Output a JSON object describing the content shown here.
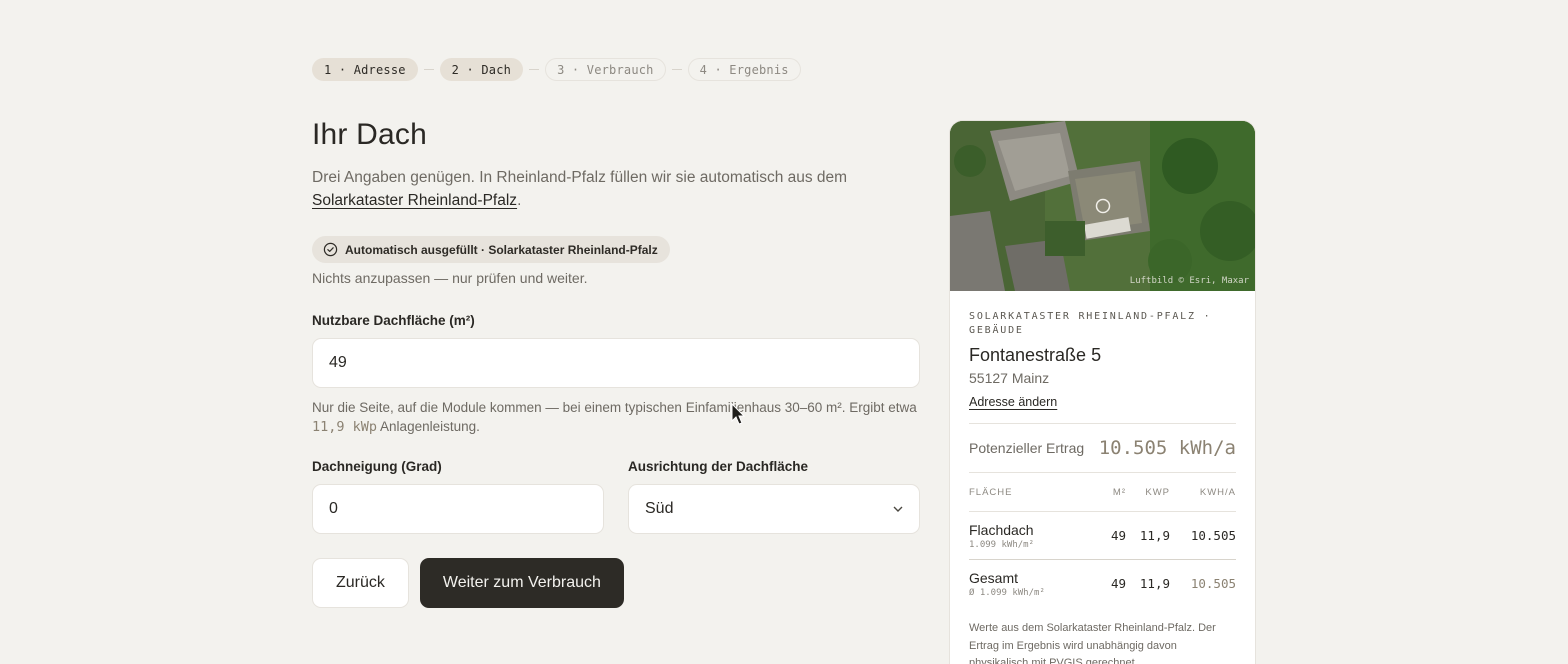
{
  "stepper": {
    "steps": [
      {
        "label": "1 · Adresse",
        "state": "done"
      },
      {
        "label": "2 · Dach",
        "state": "done"
      },
      {
        "label": "3 · Verbrauch",
        "state": "pending"
      },
      {
        "label": "4 · Ergebnis",
        "state": "pending"
      }
    ]
  },
  "main": {
    "title": "Ihr Dach",
    "intro_text": "Drei Angaben genügen. In Rheinland-Pfalz füllen wir sie automatisch aus dem",
    "intro_link": "Solarkataster Rheinland-Pfalz",
    "intro_end": ".",
    "badge": "Automatisch ausgefüllt · Solarkataster Rheinland-Pfalz",
    "badge_note": "Nichts anzupassen — nur prüfen und weiter.",
    "area": {
      "label": "Nutzbare Dachfläche (m²)",
      "value": "49",
      "help_before": "Nur die Seite, auf die Module kommen — bei einem typischen Einfamilienhaus 30–60 m². Ergibt etwa",
      "help_value": "11,9 kWp",
      "help_after": "Anlagenleistung."
    },
    "tilt": {
      "label": "Dachneigung (Grad)",
      "value": "0"
    },
    "orientation": {
      "label": "Ausrichtung der Dachfläche",
      "value": "Süd"
    },
    "buttons": {
      "back": "Zurück",
      "next": "Weiter zum Verbrauch"
    }
  },
  "card": {
    "credit": "Luftbild © Esri, Maxar",
    "eyebrow": "SOLARKATASTER RHEINLAND-PFALZ · GEBÄUDE",
    "street": "Fontanestraße 5",
    "city": "55127 Mainz",
    "change_link": "Adresse ändern",
    "yield_label": "Potenzieller Ertrag",
    "yield_value": "10.505 kWh/a",
    "table": {
      "headers": [
        "FLÄCHE",
        "M²",
        "KWP",
        "KWH/A"
      ],
      "rows": [
        {
          "name": "Flachdach",
          "sub": "1.099 kWh/m²",
          "m2": "49",
          "kwp": "11,9",
          "kwh": "10.505"
        }
      ],
      "total": {
        "name": "Gesamt",
        "sub": "Ø 1.099 kWh/m²",
        "m2": "49",
        "kwp": "11,9",
        "kwh": "10.505"
      }
    },
    "footnote": "Werte aus dem Solarkataster Rheinland-Pfalz. Der Ertrag im Ergebnis wird unabhängig davon physikalisch mit PVGIS gerechnet."
  }
}
